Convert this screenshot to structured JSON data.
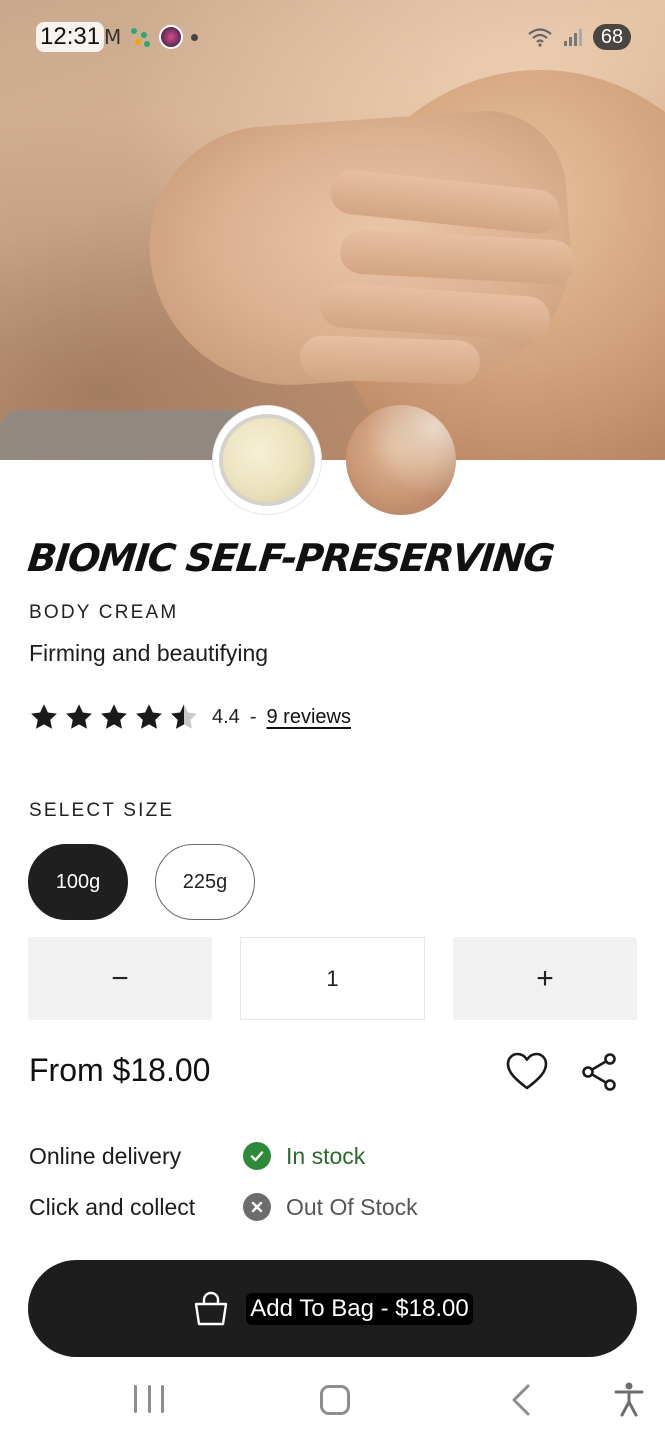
{
  "status_bar": {
    "time": "12:31",
    "battery": "68"
  },
  "product": {
    "title": "BIOMIC SELF-PRESERVING",
    "type": "BODY CREAM",
    "tagline": "Firming and beautifying",
    "rating": {
      "value": "4.4",
      "stars_filled": 4.4,
      "separator": "-",
      "reviews_label": "9 reviews"
    }
  },
  "size": {
    "label": "SELECT SIZE",
    "options": [
      "100g",
      "225g"
    ],
    "selected": "100g"
  },
  "quantity": {
    "minus": "−",
    "value": "1",
    "plus": "+"
  },
  "price": {
    "label": "From $18.00"
  },
  "availability": [
    {
      "label": "Online delivery",
      "status": "In stock",
      "state": "in-stock",
      "color": "#2e8a3b"
    },
    {
      "label": "Click and collect",
      "status": "Out Of Stock",
      "state": "out-of-stock",
      "color": "#6c6c6c"
    }
  ],
  "cta": {
    "label": "Add To Bag - $18.00"
  },
  "colors": {
    "primary": "#1d1d1d",
    "in_stock": "#2e8a3b"
  },
  "icons": {
    "wishlist": "heart-icon",
    "share": "share-icon",
    "bag": "shopping-bag-icon"
  }
}
